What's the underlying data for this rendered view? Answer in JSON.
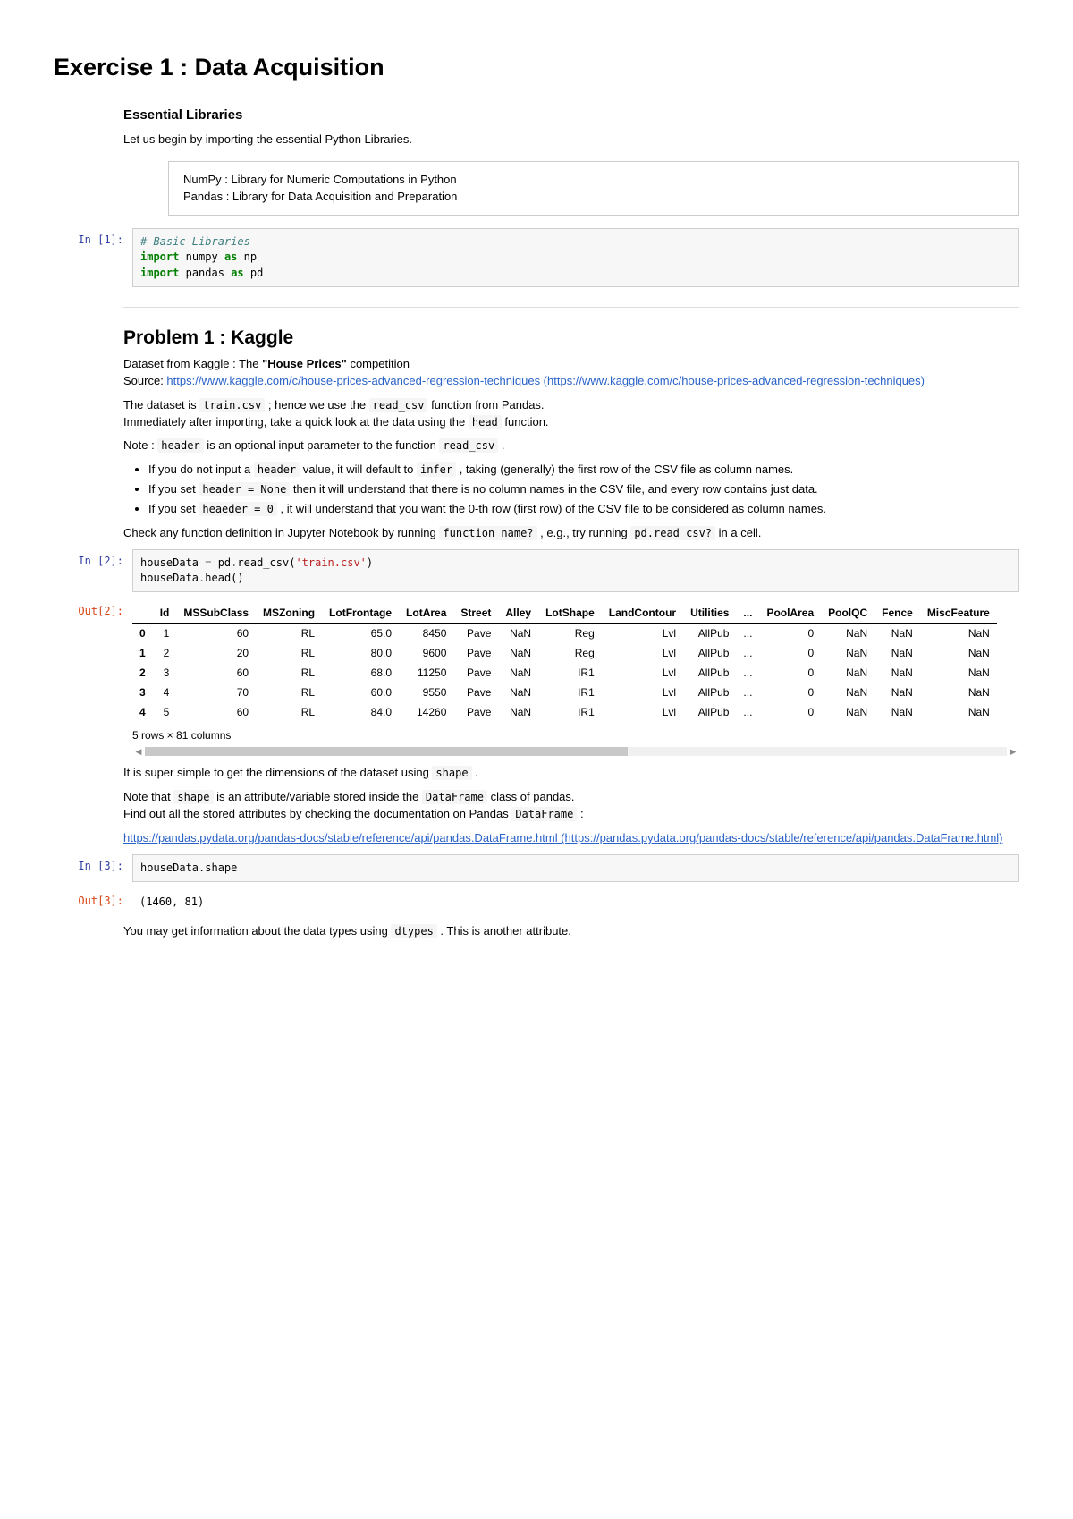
{
  "title": "Exercise 1 : Data Acquisition",
  "ess": {
    "heading": "Essential Libraries",
    "intro": "Let us begin by importing the essential Python Libraries.",
    "box_line1": "NumPy : Library for Numeric Computations in Python",
    "box_line2": "Pandas : Library for Data Acquisition and Preparation"
  },
  "cell1": {
    "prompt": "In [1]:",
    "comment": "# Basic Libraries",
    "l2a": "import",
    "l2b": "numpy",
    "l2c": "as",
    "l2d": "np",
    "l3a": "import",
    "l3b": "pandas",
    "l3c": "as",
    "l3d": "pd"
  },
  "prob1": {
    "heading": "Problem 1 : Kaggle",
    "p1a": "Dataset from Kaggle : The ",
    "p1b": "\"House Prices\"",
    "p1c": " competition",
    "p2a": "Source: ",
    "link1": "https://www.kaggle.com/c/house-prices-advanced-regression-techniques (https://www.kaggle.com/c/house-prices-advanced-regression-techniques)",
    "p3a": "The dataset is ",
    "p3b": "train.csv",
    "p3c": " ; hence we use the ",
    "p3d": "read_csv",
    "p3e": " function from Pandas.",
    "p4": "Immediately after importing, take a quick look at the data using the ",
    "p4b": "head",
    "p4c": " function.",
    "p5a": "Note : ",
    "p5b": "header",
    "p5c": " is an optional input parameter to the function ",
    "p5d": "read_csv",
    "p5e": " .",
    "li1a": "If you do not input a ",
    "li1b": "header",
    "li1c": " value, it will default to ",
    "li1d": "infer",
    "li1e": " , taking (generally) the first row of the CSV file as column names.",
    "li2a": "If you set ",
    "li2b": "header = None",
    "li2c": " then it will understand that there is no column names in the CSV file, and every row contains just data.",
    "li3a": "If you set ",
    "li3b": "heaeder = 0",
    "li3c": " , it will understand that you want the 0-th row (first row) of the CSV file to be considered as column names.",
    "p6a": "Check any function definition in Jupyter Notebook by running ",
    "p6b": "function_name?",
    "p6c": " , e.g., try running ",
    "p6d": "pd.read_csv?",
    "p6e": " in a cell."
  },
  "cell2": {
    "prompt": "In [2]:",
    "l1a": "houseData ",
    "l1b": "=",
    "l1c": " pd",
    "l1d": ".",
    "l1e": "read_csv(",
    "l1f": "'train.csv'",
    "l1g": ")",
    "l2a": "houseData",
    "l2b": ".",
    "l2c": "head()"
  },
  "out2": {
    "prompt": "Out[2]:",
    "headers": [
      "",
      "Id",
      "MSSubClass",
      "MSZoning",
      "LotFrontage",
      "LotArea",
      "Street",
      "Alley",
      "LotShape",
      "LandContour",
      "Utilities",
      "...",
      "PoolArea",
      "PoolQC",
      "Fence",
      "MiscFeature"
    ],
    "rows": [
      [
        "0",
        "1",
        "60",
        "RL",
        "65.0",
        "8450",
        "Pave",
        "NaN",
        "Reg",
        "Lvl",
        "AllPub",
        "...",
        "0",
        "NaN",
        "NaN",
        "NaN"
      ],
      [
        "1",
        "2",
        "20",
        "RL",
        "80.0",
        "9600",
        "Pave",
        "NaN",
        "Reg",
        "Lvl",
        "AllPub",
        "...",
        "0",
        "NaN",
        "NaN",
        "NaN"
      ],
      [
        "2",
        "3",
        "60",
        "RL",
        "68.0",
        "11250",
        "Pave",
        "NaN",
        "IR1",
        "Lvl",
        "AllPub",
        "...",
        "0",
        "NaN",
        "NaN",
        "NaN"
      ],
      [
        "3",
        "4",
        "70",
        "RL",
        "60.0",
        "9550",
        "Pave",
        "NaN",
        "IR1",
        "Lvl",
        "AllPub",
        "...",
        "0",
        "NaN",
        "NaN",
        "NaN"
      ],
      [
        "4",
        "5",
        "60",
        "RL",
        "84.0",
        "14260",
        "Pave",
        "NaN",
        "IR1",
        "Lvl",
        "AllPub",
        "...",
        "0",
        "NaN",
        "NaN",
        "NaN"
      ]
    ],
    "shape_note": "5 rows × 81 columns"
  },
  "post2": {
    "p1a": "It is super simple to get the dimensions of the dataset using ",
    "p1b": "shape",
    "p1c": " .",
    "p2a": "Note that ",
    "p2b": "shape",
    "p2c": " is an attribute/variable stored inside the ",
    "p2d": "DataFrame",
    "p2e": " class of pandas.",
    "p3a": "Find out all the stored attributes by checking the documentation on Pandas ",
    "p3b": "DataFrame",
    "p3c": " :",
    "link": "https://pandas.pydata.org/pandas-docs/stable/reference/api/pandas.DataFrame.html (https://pandas.pydata.org/pandas-docs/stable/reference/api/pandas.DataFrame.html)"
  },
  "cell3": {
    "prompt": "In [3]:",
    "code": "houseData.shape"
  },
  "out3": {
    "prompt": "Out[3]:",
    "text": "(1460, 81)"
  },
  "post3": {
    "p1a": "You may get information about the data types using ",
    "p1b": "dtypes",
    "p1c": " . This is another attribute."
  }
}
